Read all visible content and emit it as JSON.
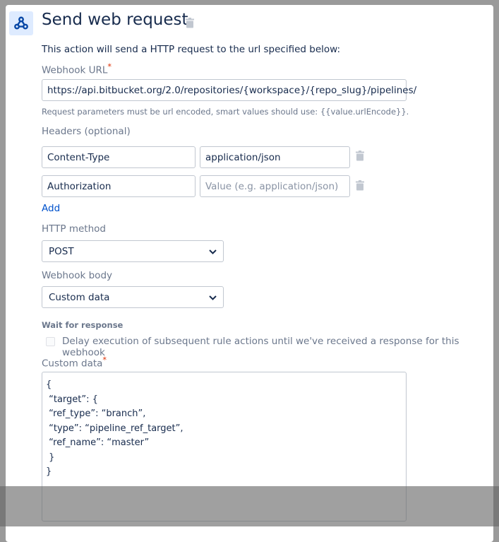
{
  "header": {
    "title": "Send web request",
    "icon": "webhook-icon"
  },
  "description": "This action will send a HTTP request to the url specified below:",
  "webhook_url": {
    "label": "Webhook URL",
    "required_mark": "*",
    "value": "https://api.bitbucket.org/2.0/repositories/{workspace}/{repo_slug}/pipelines/",
    "help": "Request parameters must be url encoded, smart values should use: {{value.urlEncode}}."
  },
  "headers": {
    "label": "Headers (optional)",
    "rows": [
      {
        "name": "Content-Type",
        "value": "application/json",
        "value_placeholder": ""
      },
      {
        "name": "Authorization",
        "value": "",
        "value_placeholder": "Value (e.g. application/json)"
      }
    ],
    "add_label": "Add"
  },
  "http_method": {
    "label": "HTTP method",
    "selected": "POST"
  },
  "webhook_body": {
    "label": "Webhook body",
    "selected": "Custom data"
  },
  "wait": {
    "heading": "Wait for response",
    "checkbox_label": "Delay execution of subsequent rule actions until we've received a response for this webhook",
    "checked": false
  },
  "custom_data": {
    "label": "Custom data",
    "required_mark": "*",
    "value": "{\n “target”: {\n “ref_type”: “branch”,\n “type”: “pipeline_ref_target”,\n “ref_name”: “master”\n }\n}"
  }
}
